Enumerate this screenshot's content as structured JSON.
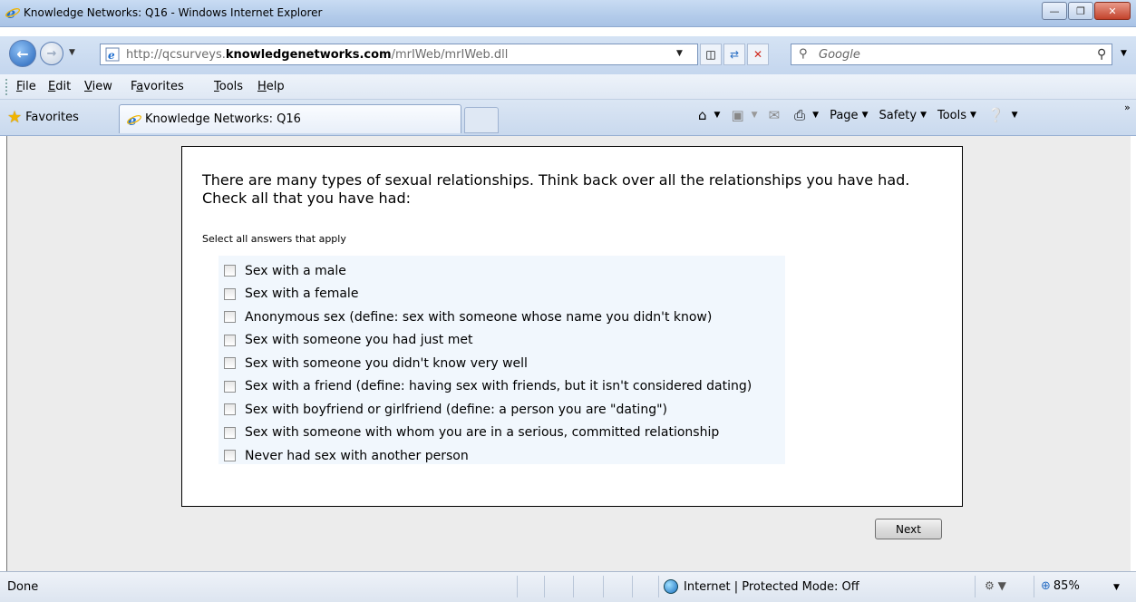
{
  "window": {
    "title": "Knowledge Networks: Q16 - Windows Internet Explorer",
    "buttons": {
      "minimize": "—",
      "maximize": "❐",
      "close": "✕"
    }
  },
  "address": {
    "url_prefix": "http://qcsurveys.",
    "url_domain": "knowledgenetworks.com",
    "url_path": "/mrIWeb/mrIWeb.dll",
    "search_placeholder": "Google"
  },
  "menu": {
    "items": [
      {
        "label": "File",
        "key": "F"
      },
      {
        "label": "Edit",
        "key": "E"
      },
      {
        "label": "View",
        "key": "V"
      },
      {
        "label": "Favorites",
        "key": "a"
      },
      {
        "label": "Tools",
        "key": "T"
      },
      {
        "label": "Help",
        "key": "H"
      }
    ]
  },
  "tabs": {
    "favorites_label": "Favorites",
    "active_tab": "Knowledge Networks: Q16"
  },
  "commandbar": {
    "page": "Page",
    "safety": "Safety",
    "tools": "Tools"
  },
  "survey": {
    "question": "There are many types of sexual relationships. Think back over all the relationships you have had. Check all that you have had:",
    "instruction": "Select all answers that apply",
    "options": [
      {
        "label": "Sex with a male",
        "checked": false
      },
      {
        "label": "Sex with a female",
        "checked": false
      },
      {
        "label": "Anonymous sex (define: sex with someone whose name you didn't know)",
        "checked": false
      },
      {
        "label": "Sex with someone you had just met",
        "checked": false
      },
      {
        "label": "Sex with someone you didn't know very well",
        "checked": false
      },
      {
        "label": "Sex with a friend (define: having sex with friends, but it isn't considered dating)",
        "checked": false
      },
      {
        "label": "Sex with boyfriend or girlfriend (define: a person you are \"dating\")",
        "checked": false
      },
      {
        "label": "Sex with someone with whom you are in a serious, committed relationship",
        "checked": false
      },
      {
        "label": "Never had sex with another person",
        "checked": false
      }
    ],
    "next_label": "Next"
  },
  "status": {
    "text": "Done",
    "zone": "Internet | Protected Mode: Off",
    "zoom": "85%"
  },
  "colors": {
    "options_background": "#f1f7fd",
    "page_background": "#ececec",
    "titlebar": "#b3cbea"
  }
}
